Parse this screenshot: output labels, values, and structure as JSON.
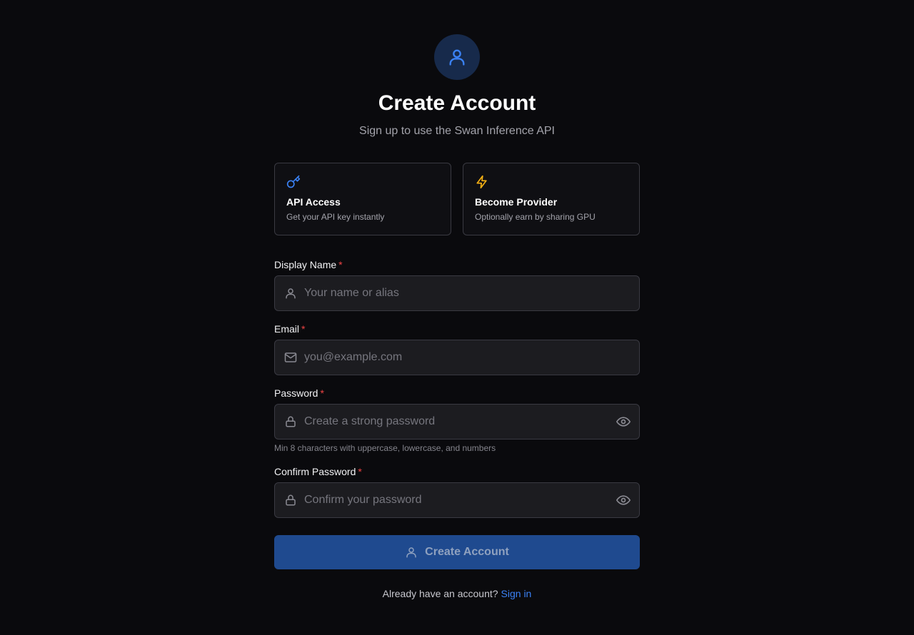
{
  "header": {
    "title": "Create Account",
    "subtitle": "Sign up to use the Swan Inference API",
    "icon": "user-icon"
  },
  "cards": [
    {
      "icon": "key-icon",
      "title": "API Access",
      "description": "Get your API key instantly",
      "icon_color": "#3b82f6"
    },
    {
      "icon": "lightning-icon",
      "title": "Become Provider",
      "description": "Optionally earn by sharing GPU",
      "icon_color": "#f5b014"
    }
  ],
  "form": {
    "display_name": {
      "label": "Display Name",
      "required_mark": "*",
      "placeholder": "Your name or alias",
      "value": "",
      "icon": "user-icon"
    },
    "email": {
      "label": "Email",
      "required_mark": "*",
      "placeholder": "you@example.com",
      "value": "",
      "icon": "mail-icon"
    },
    "password": {
      "label": "Password",
      "required_mark": "*",
      "placeholder": "Create a strong password",
      "value": "",
      "icon": "lock-icon",
      "hint": "Min 8 characters with uppercase, lowercase, and numbers"
    },
    "confirm_password": {
      "label": "Confirm Password",
      "required_mark": "*",
      "placeholder": "Confirm your password",
      "value": "",
      "icon": "lock-icon"
    },
    "submit_label": "Create Account"
  },
  "footer": {
    "prompt": "Already have an account?",
    "link_label": "Sign in"
  },
  "colors": {
    "background": "#0a0a0d",
    "accent": "#3b82f6",
    "button": "#1f4a8f",
    "required": "#ef4444",
    "provider_icon": "#f5b014"
  }
}
